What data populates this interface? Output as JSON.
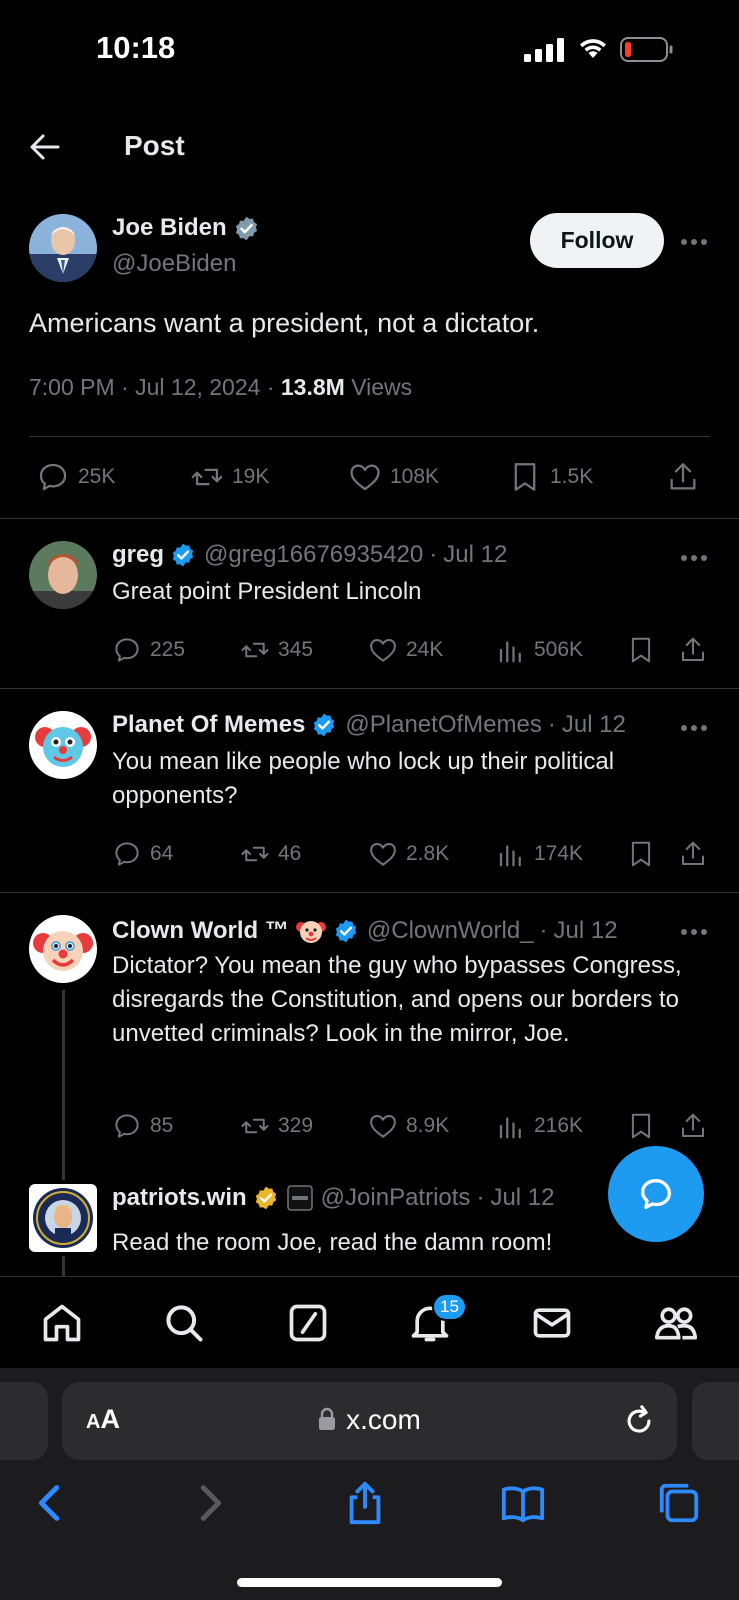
{
  "status_bar": {
    "time": "10:18"
  },
  "header": {
    "title": "Post"
  },
  "main_post": {
    "display_name": "Joe Biden",
    "handle": "@JoeBiden",
    "follow_label": "Follow",
    "text": "Americans want a president, not a dictator.",
    "time": "7:00 PM",
    "date": "Jul 12, 2024",
    "views_count": "13.8M",
    "views_label": "Views",
    "replies": "25K",
    "reposts": "19K",
    "likes": "108K",
    "bookmarks": "1.5K"
  },
  "replies": [
    {
      "display_name": "greg",
      "handle": "@greg16676935420",
      "date": "Jul 12",
      "text": "Great point President Lincoln",
      "replies": "225",
      "reposts": "345",
      "likes": "24K",
      "views": "506K"
    },
    {
      "display_name": "Planet Of Memes",
      "handle": "@PlanetOfMemes",
      "date": "Jul 12",
      "text": "You mean like people who lock up their political opponents?",
      "replies": "64",
      "reposts": "46",
      "likes": "2.8K",
      "views": "174K"
    },
    {
      "display_name": "Clown World ™",
      "handle": "@ClownWorld_",
      "date": "Jul 12",
      "text": "Dictator? You mean the guy who bypasses Congress, disregards the Constitution, and opens our borders to unvetted criminals? Look in the mirror, Joe.",
      "replies": "85",
      "reposts": "329",
      "likes": "8.9K",
      "views": "216K"
    },
    {
      "display_name": "patriots.win",
      "handle": "@JoinPatriots",
      "date": "Jul 12",
      "text": "Read the room Joe, read the damn room!"
    }
  ],
  "tabbar": {
    "notifications_badge": "15"
  },
  "safari": {
    "aa_small": "A",
    "aa_big": "A",
    "domain": "x.com"
  },
  "colors": {
    "accent": "#1d9bf0",
    "verified_gold": "#e8b829",
    "muted": "#71767b",
    "verified_gray": "#829aab"
  }
}
